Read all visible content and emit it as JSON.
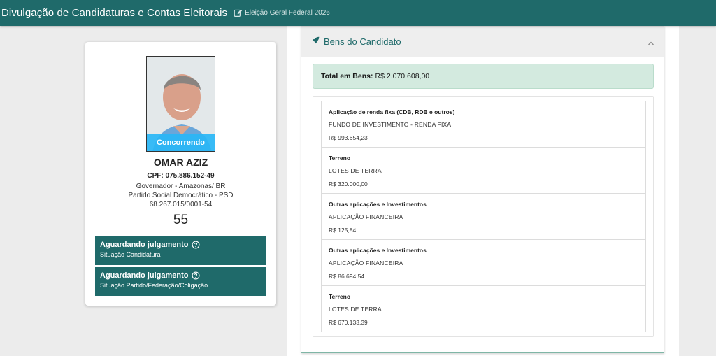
{
  "header": {
    "title": "Divulgação de Candidaturas e Contas Eleitorais",
    "election": "Eleição Geral Federal 2026"
  },
  "candidate": {
    "status_ribbon": "Concorrendo",
    "name": "OMAR AZIZ",
    "cpf": "CPF: 075.886.152-49",
    "office": "Governador - Amazonas/ BR",
    "party": "Partido Social Democrático - PSD",
    "cnpj": "68.267.015/0001-54",
    "number": "55",
    "statuses": [
      {
        "title": "Aguardando julgamento",
        "subtitle": "Situação Candidatura"
      },
      {
        "title": "Aguardando julgamento",
        "subtitle": "Situação Partido/Federação/Coligação"
      }
    ]
  },
  "assets": {
    "section_title": "Bens do Candidato",
    "total_label": "Total em Bens:",
    "total_value": "R$ 2.070.608,00",
    "items": [
      {
        "type": "Aplicação de renda fixa (CDB, RDB e outros)",
        "description": "FUNDO DE INVESTIMENTO - RENDA FIXA",
        "value": "R$ 993.654,23"
      },
      {
        "type": "Terreno",
        "description": "LOTES DE TERRA",
        "value": "R$ 320.000,00"
      },
      {
        "type": "Outras aplicações e Investimentos",
        "description": "APLICAÇÃO FINANCEIRA",
        "value": "R$ 125,84"
      },
      {
        "type": "Outras aplicações e Investimentos",
        "description": "APLICAÇÃO FINANCEIRA",
        "value": "R$ 86.694,54"
      },
      {
        "type": "Terreno",
        "description": "LOTES DE TERRA",
        "value": "R$ 670.133,39"
      }
    ]
  },
  "colors": {
    "brand": "#1f6a6a",
    "ribbon": "#29b6f6",
    "alert_bg": "#d3eadf"
  },
  "icons": {
    "header_edit": "edit-icon",
    "status_help": "question-circle-icon",
    "section": "rocket-icon",
    "collapse": "chevron-up-icon"
  }
}
